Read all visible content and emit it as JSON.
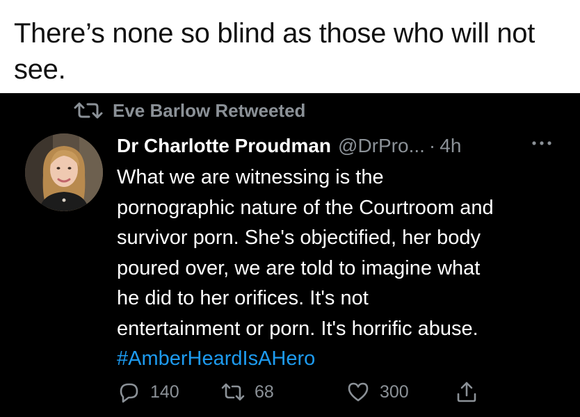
{
  "caption": {
    "line1": "There’s none so blind as those who will not",
    "line2": "see."
  },
  "retweet": {
    "label": "Eve Barlow Retweeted",
    "icon": "retweet-icon"
  },
  "tweet": {
    "author_name": "Dr Charlotte Proudman",
    "author_handle": "@DrPro...",
    "separator": "·",
    "time": "4h",
    "more_icon": "more-dots-icon",
    "body_lines": [
      "What we are witnessing is the",
      "pornographic nature of the Courtroom and",
      "survivor porn. She's objectified, her body",
      "poured over, we are told to imagine what",
      "he did to her orifices. It's not",
      "entertainment or porn. It's horrific abuse."
    ],
    "hashtag": "#AmberHeardIsAHero"
  },
  "actions": {
    "reply_count": "140",
    "retweet_count": "68",
    "like_count": "300"
  },
  "colors": {
    "background": "#000000",
    "secondary_text": "#8b9197",
    "hashtag": "#1d9bf0"
  }
}
